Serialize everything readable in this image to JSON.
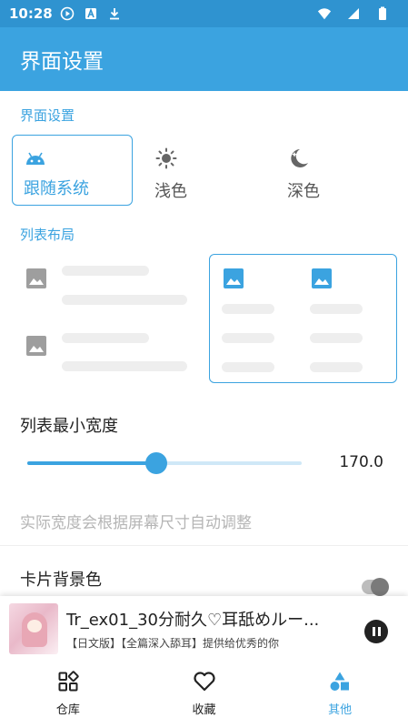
{
  "status_bar": {
    "time": "10:28",
    "icons": [
      "play-circle-icon",
      "a-box-icon",
      "download-icon",
      "wifi-icon",
      "signal-icon",
      "battery-icon"
    ]
  },
  "app_bar": {
    "title": "界面设置"
  },
  "theme_section": {
    "title": "界面设置",
    "options": [
      {
        "label": "跟随系统",
        "icon": "android-icon",
        "selected": true
      },
      {
        "label": "浅色",
        "icon": "sun-icon",
        "selected": false
      },
      {
        "label": "深色",
        "icon": "moon-icon",
        "selected": false
      }
    ]
  },
  "layout_section": {
    "title": "列表布局",
    "options": [
      {
        "name": "list",
        "selected": false
      },
      {
        "name": "grid",
        "selected": true
      }
    ]
  },
  "min_width": {
    "label": "列表最小宽度",
    "value_text": "170.0",
    "slider_fraction": 0.47,
    "hint": "实际宽度会根据屏幕尺寸自动调整"
  },
  "card_bg": {
    "label": "卡片背景色"
  },
  "now_playing": {
    "title": "Tr_ex01_30分耐久♡耳舐めルー...",
    "subtitle": "【日文版】【全篇深入舔耳】提供给优秀的你"
  },
  "bottom_nav": {
    "items": [
      {
        "label": "仓库",
        "icon": "grid-squares-icon",
        "active": false
      },
      {
        "label": "收藏",
        "icon": "heart-icon",
        "active": false
      },
      {
        "label": "其他",
        "icon": "shapes-icon",
        "active": true
      }
    ]
  },
  "colors": {
    "accent": "#3ba3e0",
    "status_bar": "#2f93d0",
    "hint": "#b5b5b5",
    "placeholder": "#eeeeee"
  }
}
